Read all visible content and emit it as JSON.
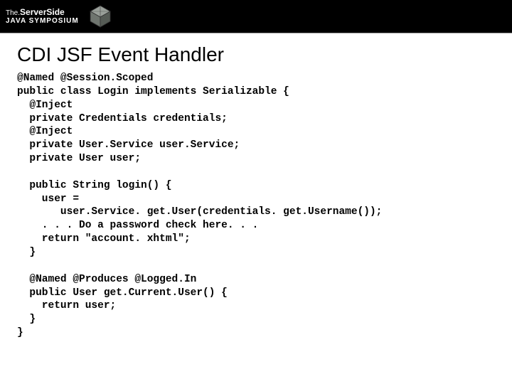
{
  "header": {
    "logo_line1_prefix": "The.",
    "logo_line1_main": "ServerSide",
    "logo_line2": "JAVA SYMPOSIUM"
  },
  "slide": {
    "title": "CDI JSF Event Handler",
    "code": "@Named @Session.Scoped\npublic class Login implements Serializable {\n  @Inject\n  private Credentials credentials;\n  @Inject\n  private User.Service user.Service;\n  private User user;\n\n  public String login() {\n    user =\n       user.Service. get.User(credentials. get.Username());\n    . . . Do a password check here. . .\n    return \"account. xhtml\";\n  }\n\n  @Named @Produces @Logged.In\n  public User get.Current.User() {\n    return user;\n  }\n}"
  }
}
